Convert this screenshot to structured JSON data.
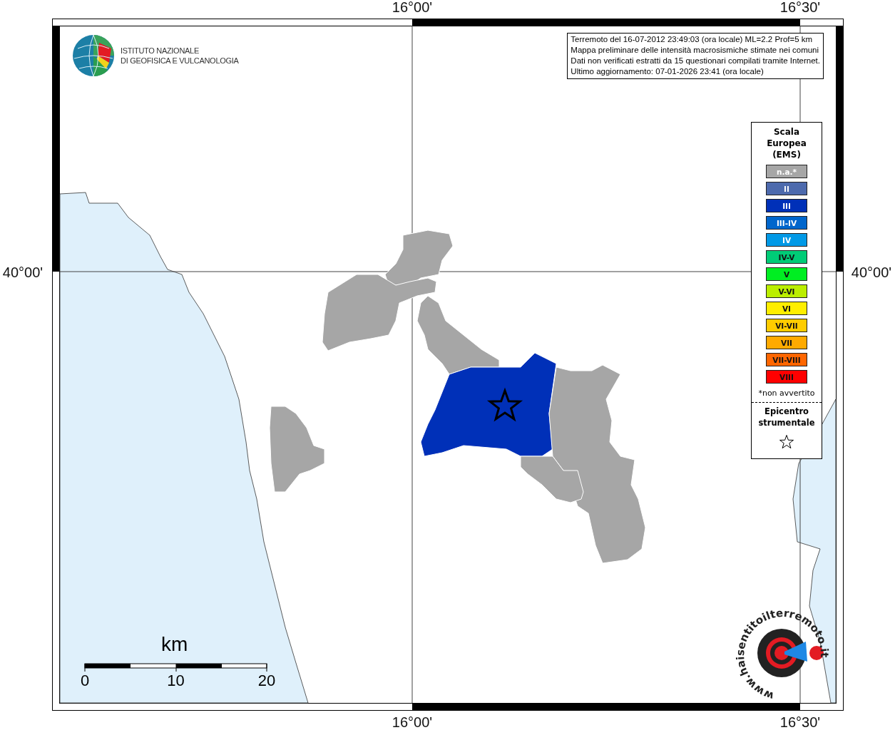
{
  "logo": {
    "lines": [
      "ISTITUTO NAZIONALE",
      "DI GEOFISICA E VULCANOLOGIA"
    ]
  },
  "info": [
    "Terremoto del 16-07-2012 23:49:03 (ora locale) ML=2.2 Prof=5 km",
    "Mappa preliminare delle intensità macrosismiche stimate nei comuni",
    "Dati non verificati estratti da 15 questionari compilati tramite Internet.",
    "Ultimo aggiornamento: 07-01-2026 23:41 (ora locale)"
  ],
  "axes": {
    "top": [
      "16°00'",
      "16°30'"
    ],
    "bottom": [
      "16°00'",
      "16°30'"
    ],
    "left": "40°00'",
    "right": "40°00'"
  },
  "legend": {
    "title": "Scala Europea (EMS)",
    "items": [
      {
        "label": "n.a.*",
        "color": "#a6a6a6"
      },
      {
        "label": "II",
        "color": "#4d6aad"
      },
      {
        "label": "III",
        "color": "#0030b8"
      },
      {
        "label": "III-IV",
        "color": "#0066cc"
      },
      {
        "label": "IV",
        "color": "#0099e6"
      },
      {
        "label": "IV-V",
        "color": "#00cc77"
      },
      {
        "label": "V",
        "color": "#00ee22"
      },
      {
        "label": "V-VI",
        "color": "#bbee00"
      },
      {
        "label": "VI",
        "color": "#ffee00"
      },
      {
        "label": "VI-VII",
        "color": "#ffcc00"
      },
      {
        "label": "VII",
        "color": "#ffaa00"
      },
      {
        "label": "VII-VIII",
        "color": "#ff6600"
      },
      {
        "label": "VIII",
        "color": "#ff0000"
      }
    ],
    "note": "*non avvertito",
    "epicenter": "Epicentro strumentale"
  },
  "municipalities": [
    {
      "color": "#a6a6a6"
    },
    {
      "color": "#a6a6a6"
    },
    {
      "color": "#a6a6a6"
    },
    {
      "color": "#0030b8"
    },
    {
      "color": "#a6a6a6"
    },
    {
      "color": "#a6a6a6"
    },
    {
      "color": "#a6a6a6"
    }
  ],
  "scale_bar": {
    "unit": "km",
    "ticks": [
      "0",
      "10",
      "20"
    ]
  },
  "badge": {
    "text": "www.haisentitoilterremoto.it"
  }
}
